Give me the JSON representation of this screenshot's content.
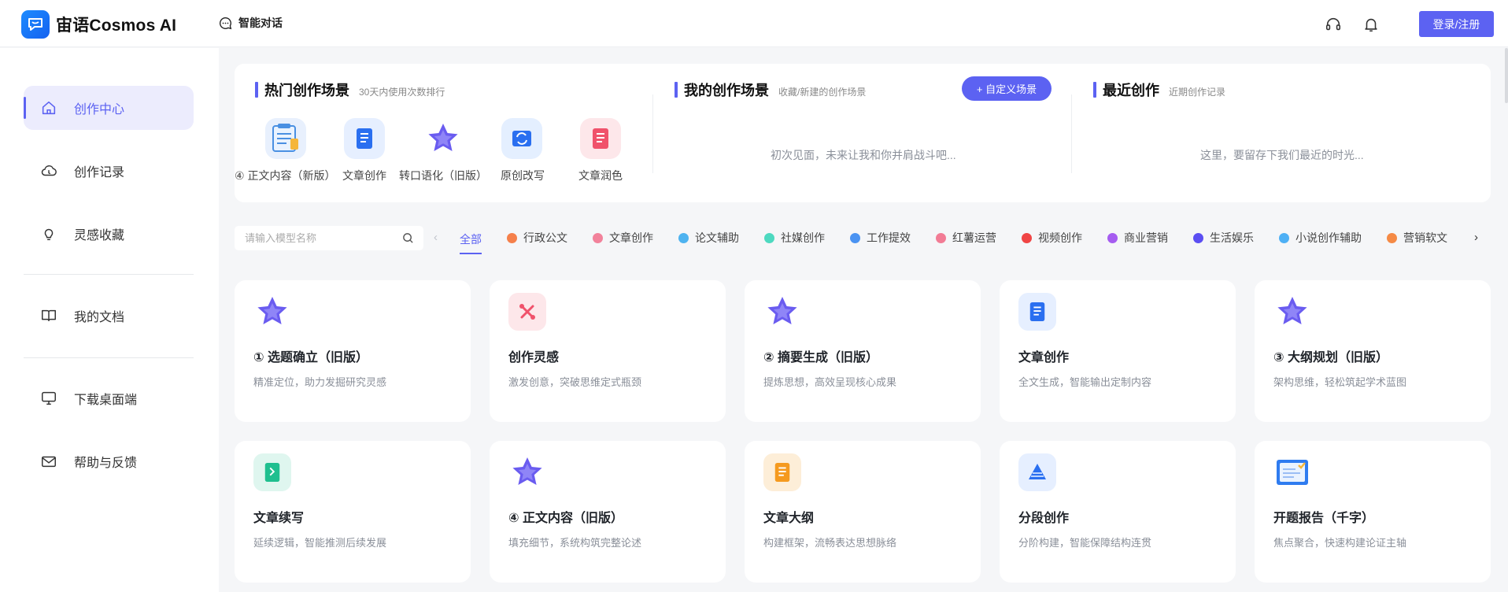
{
  "brand": {
    "name": "宙语Cosmos AI"
  },
  "topnav": {
    "chat_label": "智能对话",
    "login_label": "登录/注册"
  },
  "sidebar": {
    "items": [
      {
        "label": "创作中心",
        "icon": "home-icon"
      },
      {
        "label": "创作记录",
        "icon": "cloud-icon"
      },
      {
        "label": "灵感收藏",
        "icon": "bulb-icon"
      },
      {
        "label": "我的文档",
        "icon": "book-icon"
      },
      {
        "label": "下载桌面端",
        "icon": "monitor-icon"
      },
      {
        "label": "帮助与反馈",
        "icon": "mail-icon"
      }
    ]
  },
  "hot": {
    "title": "热门创作场景",
    "subtitle": "30天内使用次数排行",
    "items": [
      {
        "label": "④ 正文内容（新版）",
        "icon": "document-board-icon"
      },
      {
        "label": "文章创作",
        "icon": "article-icon"
      },
      {
        "label": "转口语化（旧版）",
        "icon": "star-icon"
      },
      {
        "label": "原创改写",
        "icon": "rewrite-icon"
      },
      {
        "label": "文章润色",
        "icon": "polish-icon"
      }
    ]
  },
  "mine": {
    "title": "我的创作场景",
    "subtitle": "收藏/新建的创作场景",
    "custom_label": "+ 自定义场景",
    "empty": "初次见面，未来让我和你并肩战斗吧..."
  },
  "recent": {
    "title": "最近创作",
    "subtitle": "近期创作记录",
    "empty": "这里，要留存下我们最近的时光..."
  },
  "filter": {
    "search_placeholder": "请输入模型名称",
    "all_label": "全部",
    "categories": [
      {
        "label": "行政公文",
        "color": "#f5804b"
      },
      {
        "label": "文章创作",
        "color": "#f2829b"
      },
      {
        "label": "论文辅助",
        "color": "#4eb3f0"
      },
      {
        "label": "社媒创作",
        "color": "#4dd9c0"
      },
      {
        "label": "工作提效",
        "color": "#4a93f2"
      },
      {
        "label": "红薯运营",
        "color": "#f27c95"
      },
      {
        "label": "视频创作",
        "color": "#f04545"
      },
      {
        "label": "商业营销",
        "color": "#a55cf0"
      },
      {
        "label": "生活娱乐",
        "color": "#5b4ef2"
      },
      {
        "label": "小说创作辅助",
        "color": "#4eb0f5"
      },
      {
        "label": "营销软文",
        "color": "#f58a45"
      }
    ]
  },
  "cards": [
    {
      "title": "① 选题确立（旧版）",
      "desc": "精准定位，助力发掘研究灵感",
      "icon": "star-icon"
    },
    {
      "title": "创作灵感",
      "desc": "激发创意，突破思维定式瓶颈",
      "icon": "scissors-icon"
    },
    {
      "title": "② 摘要生成（旧版）",
      "desc": "提炼思想，高效呈现核心成果",
      "icon": "star-icon"
    },
    {
      "title": "文章创作",
      "desc": "全文生成，智能输出定制内容",
      "icon": "article-icon"
    },
    {
      "title": "③ 大纲规划（旧版）",
      "desc": "架构思维，轻松筑起学术蓝图",
      "icon": "star-icon"
    },
    {
      "title": "文章续写",
      "desc": "延续逻辑，智能推测后续发展",
      "icon": "notebook-icon"
    },
    {
      "title": "④ 正文内容（旧版）",
      "desc": "填充细节，系统构筑完整论述",
      "icon": "star-icon"
    },
    {
      "title": "文章大纲",
      "desc": "构建框架，流畅表达思想脉络",
      "icon": "outline-icon"
    },
    {
      "title": "分段创作",
      "desc": "分阶构建，智能保障结构连贯",
      "icon": "layers-icon"
    },
    {
      "title": "开题报告（千字）",
      "desc": "焦点聚合，快速构建论证主轴",
      "icon": "report-icon"
    }
  ]
}
